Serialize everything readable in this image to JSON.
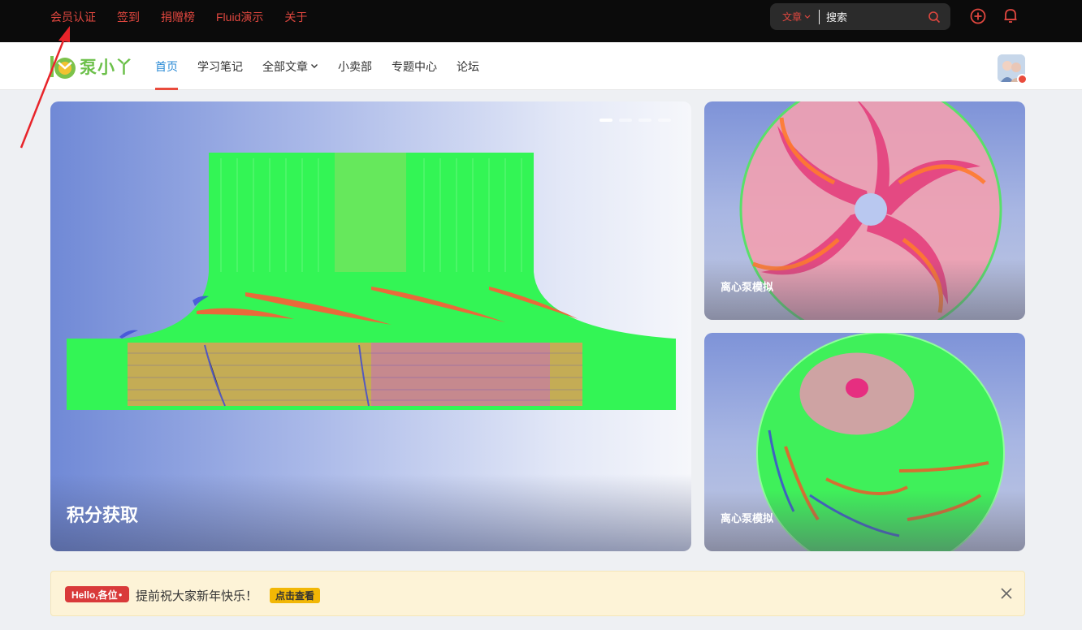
{
  "topbar": {
    "links": [
      "会员认证",
      "签到",
      "捐赠榜",
      "Fluid演示",
      "关于"
    ],
    "search": {
      "type_label": "文章",
      "placeholder": "搜索"
    },
    "accent_color": "#e0473f"
  },
  "header": {
    "logo_text": "泵小丫",
    "nav": [
      {
        "label": "首页",
        "active": true
      },
      {
        "label": "学习笔记"
      },
      {
        "label": "全部文章",
        "has_dropdown": true
      },
      {
        "label": "小卖部"
      },
      {
        "label": "专题中心"
      },
      {
        "label": "论坛"
      }
    ]
  },
  "slider": {
    "caption": "积分获取",
    "dots": 4,
    "active_dot": 0
  },
  "cards": [
    {
      "caption": "离心泵模拟"
    },
    {
      "caption": "离心泵模拟"
    }
  ],
  "notice": {
    "badge": "Hello,各位",
    "text": "提前祝大家新年快乐！",
    "button": "点击查看"
  },
  "icons": [
    "chevron-down-icon",
    "search-icon",
    "plus-icon",
    "bell-icon",
    "close-icon",
    "verified-badge-icon"
  ]
}
